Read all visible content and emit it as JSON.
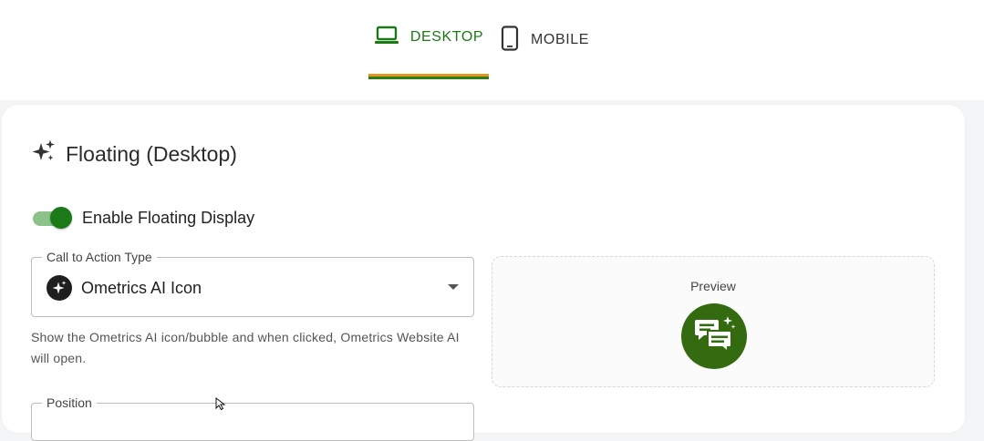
{
  "tabs": {
    "desktop": {
      "label": "DESKTOP",
      "icon": "laptop-icon"
    },
    "mobile": {
      "label": "MOBILE",
      "icon": "phone-icon"
    }
  },
  "section": {
    "title": "Floating (Desktop)",
    "icon": "sparkles-icon"
  },
  "toggle": {
    "label": "Enable Floating Display",
    "enabled": true
  },
  "cta_field": {
    "label": "Call to Action Type",
    "value": "Ometrics AI Icon",
    "icon": "ai-sparkle-icon",
    "helper": "Show the Ometrics AI icon/bubble and when clicked, Ometrics Website AI will open."
  },
  "position_field": {
    "label": "Position"
  },
  "preview": {
    "label": "Preview",
    "icon": "chat-sparkle-icon"
  },
  "colors": {
    "primary_green": "#1c7a14",
    "indicator_orange": "#e6941c",
    "indicator_green": "#2f7d0e",
    "bubble_green": "#346b11",
    "switch_track": "#8cc38b"
  }
}
